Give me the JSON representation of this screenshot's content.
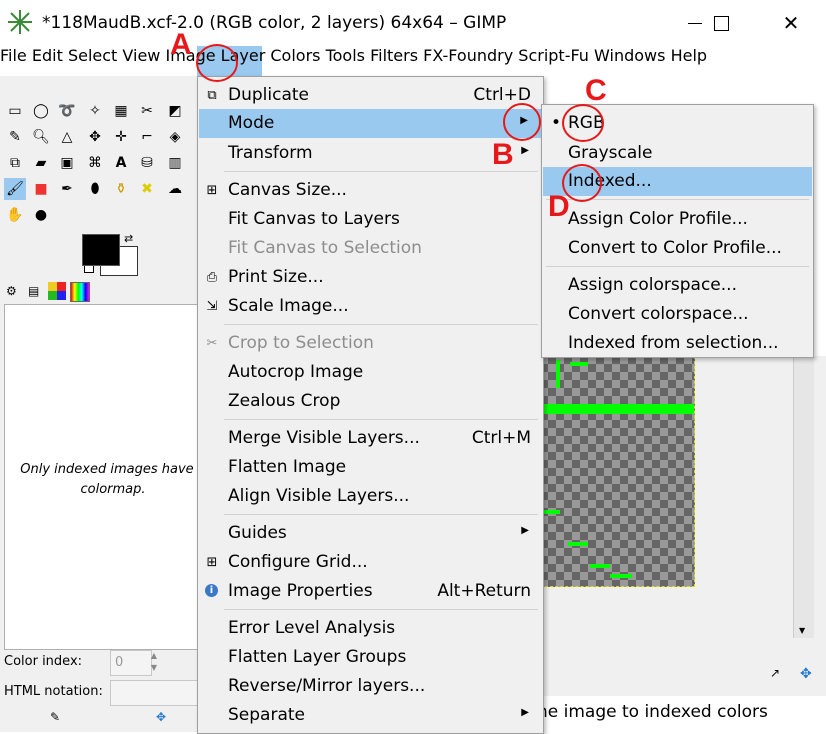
{
  "window": {
    "title": "*118MaudB.xcf-2.0 (RGB color, 2 layers) 64x64 – GIMP"
  },
  "menubar": [
    {
      "label": "File"
    },
    {
      "label": "Edit"
    },
    {
      "label": "Select"
    },
    {
      "label": "View"
    },
    {
      "label": "Image"
    },
    {
      "label": "Layer"
    },
    {
      "label": "Colors"
    },
    {
      "label": "Tools"
    },
    {
      "label": "Filters"
    },
    {
      "label": "FX-Foundry"
    },
    {
      "label": "Script-Fu"
    },
    {
      "label": "Windows"
    },
    {
      "label": "Help"
    }
  ],
  "image_menu": [
    {
      "label": "Duplicate",
      "accel": "Ctrl+D"
    },
    {
      "label": "Mode",
      "submenu": true
    },
    {
      "label": "Transform",
      "submenu": true
    },
    {
      "label": "Canvas Size..."
    },
    {
      "label": "Fit Canvas to Layers"
    },
    {
      "label": "Fit Canvas to Selection",
      "disabled": true
    },
    {
      "label": "Print Size..."
    },
    {
      "label": "Scale Image..."
    },
    {
      "label": "Crop to Selection",
      "disabled": true
    },
    {
      "label": "Autocrop Image"
    },
    {
      "label": "Zealous Crop"
    },
    {
      "label": "Merge Visible Layers...",
      "accel": "Ctrl+M"
    },
    {
      "label": "Flatten Image"
    },
    {
      "label": "Align Visible Layers..."
    },
    {
      "label": "Guides",
      "submenu": true
    },
    {
      "label": "Configure Grid..."
    },
    {
      "label": "Image Properties",
      "accel": "Alt+Return"
    },
    {
      "label": "Error Level Analysis"
    },
    {
      "label": "Flatten Layer Groups"
    },
    {
      "label": "Reverse/Mirror layers..."
    },
    {
      "label": "Separate",
      "submenu": true
    }
  ],
  "mode_menu": [
    {
      "label": "RGB",
      "checked": true
    },
    {
      "label": "Grayscale"
    },
    {
      "label": "Indexed..."
    },
    {
      "label": "Assign Color Profile..."
    },
    {
      "label": "Convert to Color Profile..."
    },
    {
      "label": "Assign colorspace..."
    },
    {
      "label": "Convert colorspace..."
    },
    {
      "label": "Indexed from selection..."
    }
  ],
  "colormap_panel": {
    "message": "Only indexed images have a colormap.",
    "color_index_label": "Color index:",
    "color_index_value": "0",
    "html_notation_label": "HTML notation:"
  },
  "statusbar": {
    "text": "he image to indexed colors"
  },
  "annotations": {
    "a": "A",
    "b": "B",
    "c": "C",
    "d": "D"
  },
  "colors": {
    "highlight": "#99c9ef",
    "annotation": "#e8181a",
    "canvas_green": "#00ff00"
  }
}
